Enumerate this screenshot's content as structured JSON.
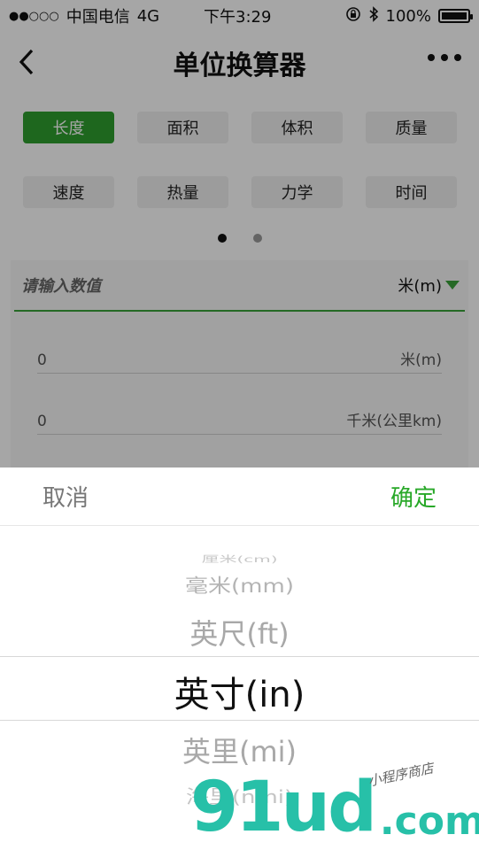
{
  "status_bar": {
    "signal_dots": "●●○○○",
    "carrier": "中国电信",
    "network": "4G",
    "time": "下午3:29",
    "battery_percent": "100%"
  },
  "nav": {
    "title": "单位换算器"
  },
  "tabs": {
    "row1": [
      "长度",
      "面积",
      "体积",
      "质量"
    ],
    "row2": [
      "速度",
      "热量",
      "力学",
      "时间"
    ],
    "active": "长度"
  },
  "input": {
    "placeholder": "请输入数值",
    "unit": "米(m)"
  },
  "results": [
    {
      "value": "0",
      "unit": "米(m)"
    },
    {
      "value": "0",
      "unit": "千米(公里km)"
    }
  ],
  "picker": {
    "cancel_label": "取消",
    "confirm_label": "确定",
    "items": [
      "厘米(cm)",
      "毫米(mm)",
      "英尺(ft)",
      "英寸(in)",
      "英里(mi)",
      "海里(nmi)"
    ],
    "selected": "英寸(in)"
  },
  "watermark": {
    "main": "91ud",
    "suffix": ".com",
    "tagline": "小程序商店"
  },
  "colors": {
    "accent": "#2e9f2e",
    "confirm": "#28a828",
    "watermark": "#27c0a8"
  }
}
